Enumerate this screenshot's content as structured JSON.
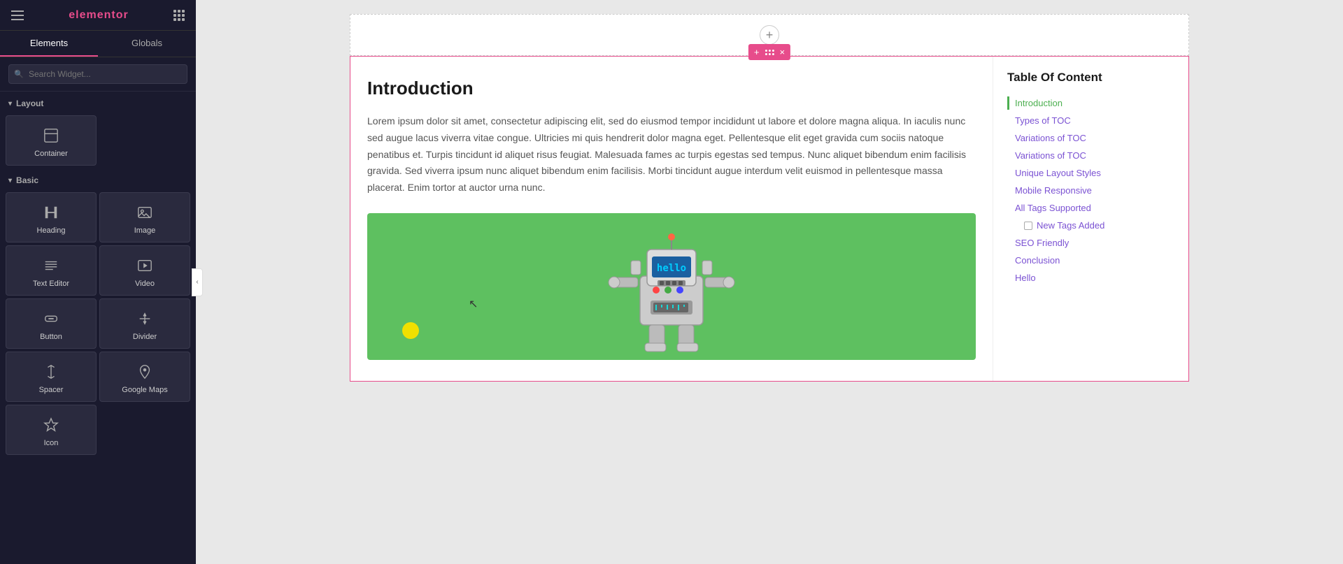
{
  "sidebar": {
    "logo": "elementor",
    "tabs": [
      {
        "label": "Elements",
        "active": true
      },
      {
        "label": "Globals",
        "active": false
      }
    ],
    "search": {
      "placeholder": "Search Widget..."
    },
    "sections": [
      {
        "id": "layout",
        "label": "Layout",
        "widgets": [
          {
            "id": "container",
            "label": "Container",
            "icon": "container-icon"
          }
        ]
      },
      {
        "id": "basic",
        "label": "Basic",
        "widgets": [
          {
            "id": "heading",
            "label": "Heading",
            "icon": "heading-icon"
          },
          {
            "id": "image",
            "label": "Image",
            "icon": "image-icon"
          },
          {
            "id": "text-editor",
            "label": "Text Editor",
            "icon": "text-editor-icon"
          },
          {
            "id": "video",
            "label": "Video",
            "icon": "video-icon"
          },
          {
            "id": "button",
            "label": "Button",
            "icon": "button-icon"
          },
          {
            "id": "divider",
            "label": "Divider",
            "icon": "divider-icon"
          },
          {
            "id": "spacer",
            "label": "Spacer",
            "icon": "spacer-icon"
          },
          {
            "id": "google-maps",
            "label": "Google Maps",
            "icon": "google-maps-icon"
          },
          {
            "id": "icon",
            "label": "Icon",
            "icon": "icon-widget-icon"
          }
        ]
      }
    ]
  },
  "toolbar": {
    "add_label": "+",
    "move_label": "⠿",
    "close_label": "×"
  },
  "content": {
    "title": "Introduction",
    "body": "Lorem ipsum dolor sit amet, consectetur adipiscing elit, sed do eiusmod tempor incididunt ut labore et dolore magna aliqua. In iaculis nunc sed augue lacus viverra vitae congue. Ultricies mi quis hendrerit dolor magna eget. Pellentesque elit eget gravida cum sociis natoque penatibus et. Turpis tincidunt id aliquet risus feugiat. Malesuada fames ac turpis egestas sed tempus. Nunc aliquet bibendum enim facilisis gravida. Sed viverra ipsum nunc aliquet bibendum enim facilisis. Morbi tincidunt augue interdum velit euismod in pellentesque massa placerat. Enim tortor at auctor urna nunc."
  },
  "toc": {
    "title": "Table Of Content",
    "items": [
      {
        "label": "Introduction",
        "active": true,
        "indent": 0
      },
      {
        "label": "Types of TOC",
        "active": false,
        "indent": 0
      },
      {
        "label": "Variations of TOC",
        "active": false,
        "indent": 0
      },
      {
        "label": "Variations of TOC",
        "active": false,
        "indent": 0
      },
      {
        "label": "Unique Layout Styles",
        "active": false,
        "indent": 0
      },
      {
        "label": "Mobile Responsive",
        "active": false,
        "indent": 0
      },
      {
        "label": "All Tags Supported",
        "active": false,
        "indent": 0
      },
      {
        "label": "New Tags Added",
        "active": false,
        "indent": 1
      },
      {
        "label": "SEO Friendly",
        "active": false,
        "indent": 0
      },
      {
        "label": "Conclusion",
        "active": false,
        "indent": 0
      },
      {
        "label": "Hello",
        "active": false,
        "indent": 0
      }
    ]
  }
}
